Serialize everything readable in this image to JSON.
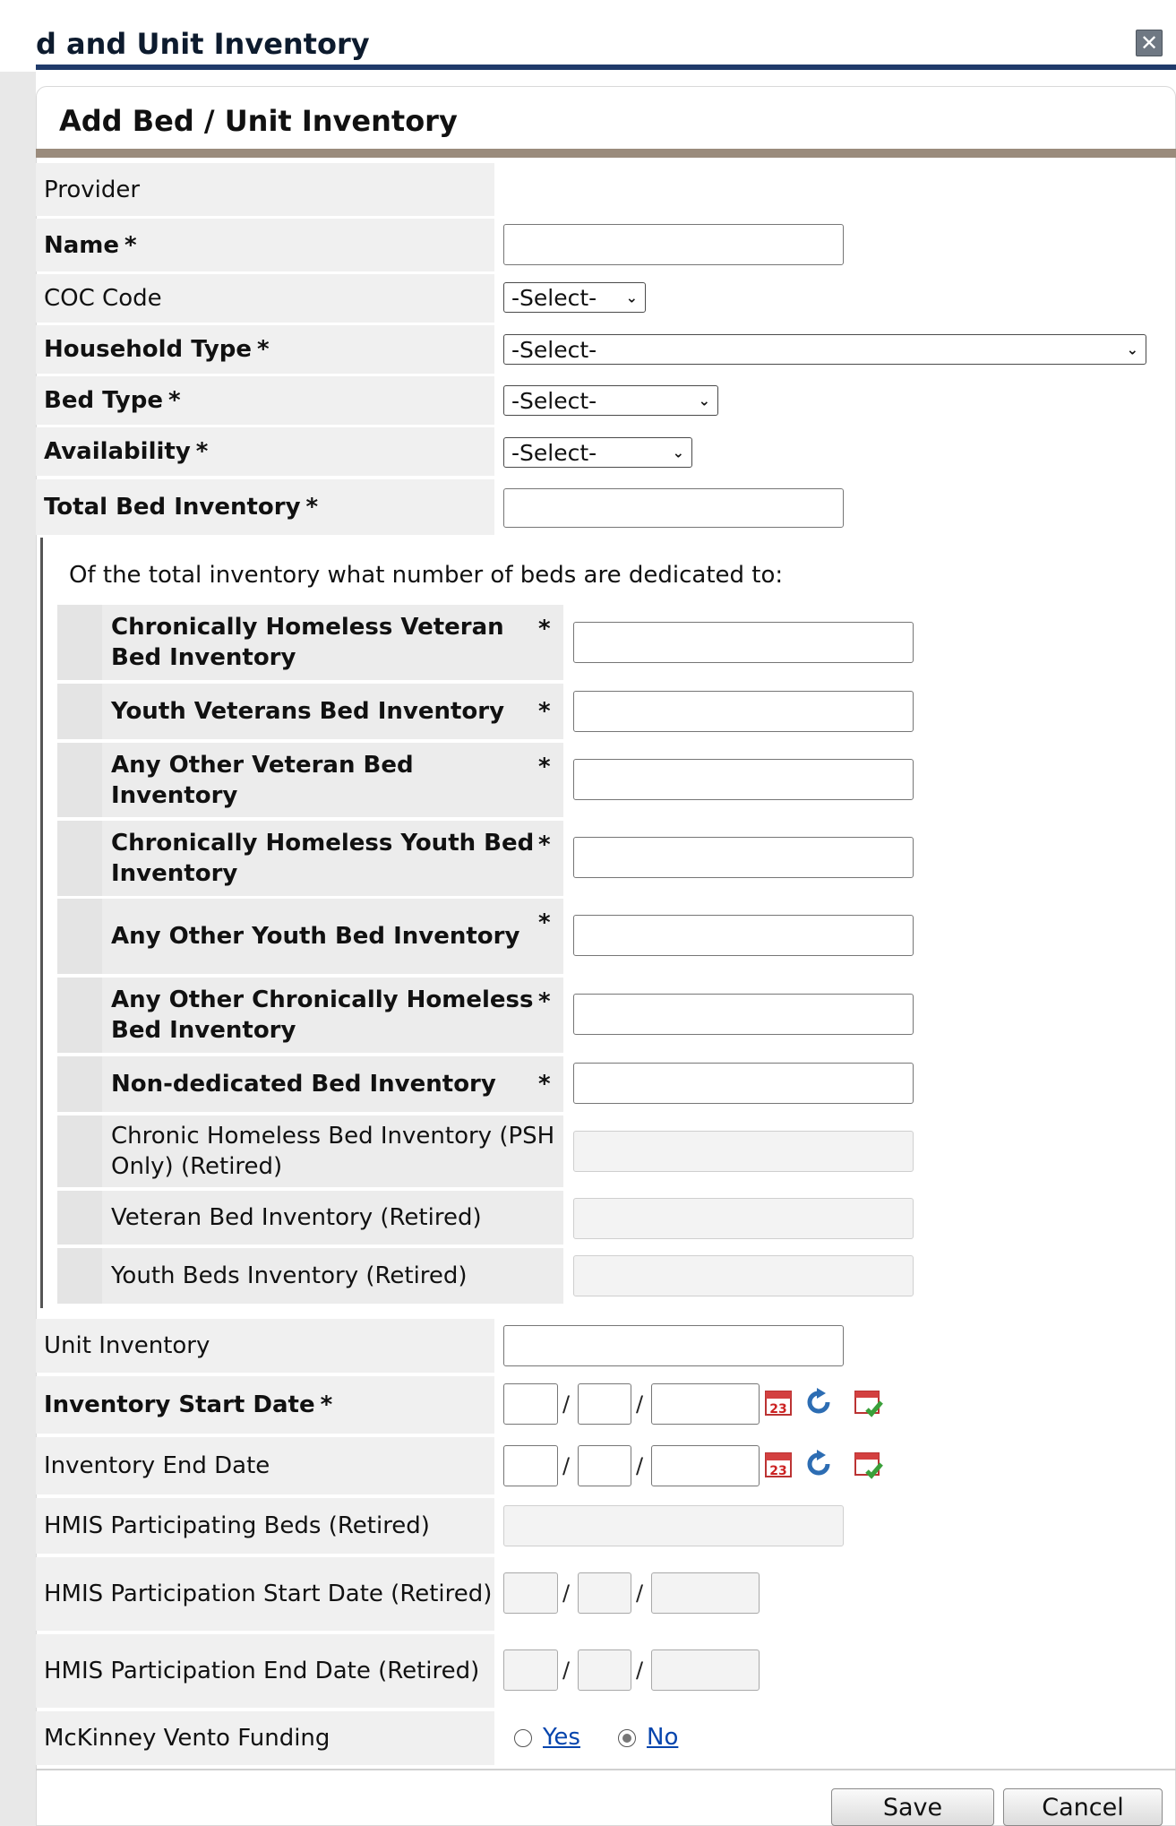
{
  "window": {
    "title": "d and Unit Inventory",
    "close_glyph": "✕"
  },
  "panel": {
    "header": "Add Bed / Unit Inventory"
  },
  "fields": {
    "provider": {
      "label": "Provider"
    },
    "name": {
      "label": "Name",
      "required": "*"
    },
    "coc_code": {
      "label": "COC Code",
      "value": "-Select-"
    },
    "household_type": {
      "label": "Household Type",
      "required": "*",
      "value": "-Select-"
    },
    "bed_type": {
      "label": "Bed Type",
      "required": "*",
      "value": "-Select-"
    },
    "availability": {
      "label": "Availability",
      "required": "*",
      "value": "-Select-"
    },
    "total_bed_inventory": {
      "label": "Total Bed Inventory",
      "required": "*"
    }
  },
  "dedicated": {
    "intro": "Of the total inventory what number of beds are dedicated to:",
    "items": [
      {
        "label": "Chronically Homeless Veteran Bed Inventory",
        "required": "*"
      },
      {
        "label": "Youth Veterans Bed Inventory",
        "required": "*"
      },
      {
        "label": "Any Other Veteran Bed Inventory",
        "required": "*"
      },
      {
        "label": "Chronically Homeless Youth Bed Inventory",
        "required": "*"
      },
      {
        "label": "Any Other Youth Bed Inventory",
        "required": "*"
      },
      {
        "label": "Any Other Chronically Homeless Bed Inventory",
        "required": "*"
      },
      {
        "label": "Non-dedicated Bed Inventory",
        "required": "*"
      },
      {
        "label": "Chronic Homeless Bed Inventory (PSH Only) (Retired)"
      },
      {
        "label": "Veteran Bed Inventory (Retired)"
      },
      {
        "label": "Youth Beds Inventory (Retired)"
      }
    ]
  },
  "lower": {
    "unit_inventory": {
      "label": "Unit Inventory"
    },
    "inventory_start_date": {
      "label": "Inventory Start Date",
      "required": "*"
    },
    "inventory_end_date": {
      "label": "Inventory End Date"
    },
    "hmis_participating_beds": {
      "label": "HMIS Participating Beds (Retired)"
    },
    "hmis_participation_start": {
      "label": "HMIS Participation Start Date (Retired)"
    },
    "hmis_participation_end": {
      "label": "HMIS Participation End Date (Retired)"
    },
    "mckinney_vento": {
      "label": "McKinney Vento Funding",
      "yes": "Yes",
      "no": "No",
      "selected": "No"
    }
  },
  "date_separator": "/",
  "buttons": {
    "save": "Save",
    "cancel": "Cancel"
  },
  "colors": {
    "title_rule": "#1f3a6a",
    "panel_rule": "#9a8b7c",
    "label_bg": "#f0f0f0",
    "link": "#0645ad"
  }
}
